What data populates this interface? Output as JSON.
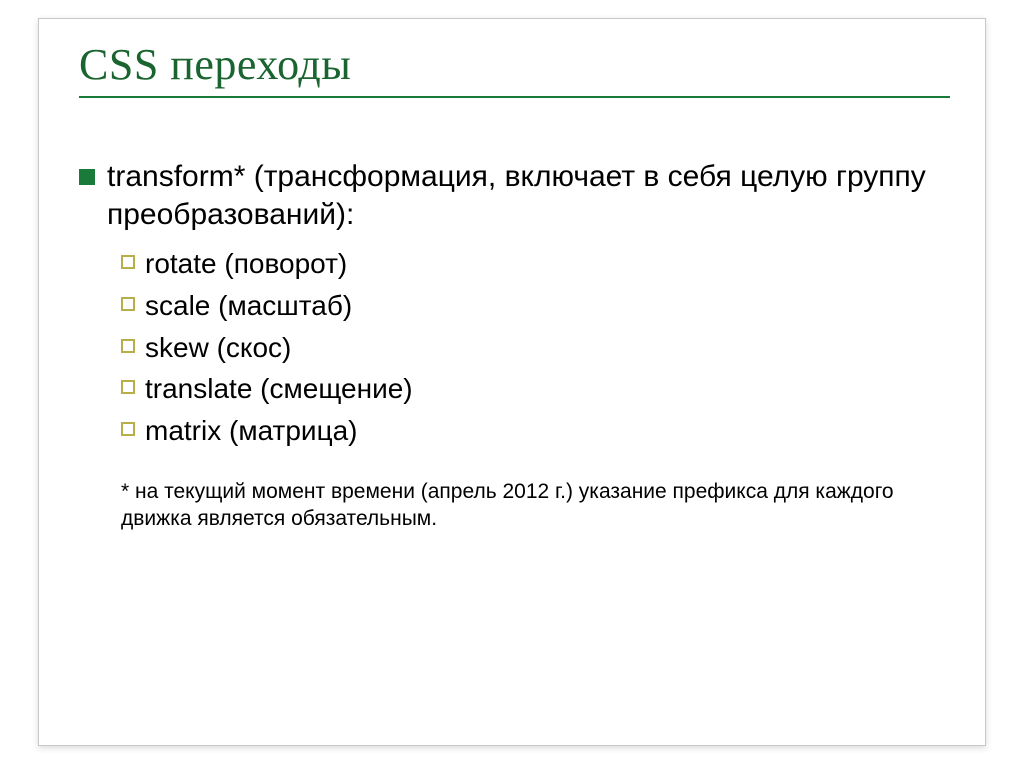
{
  "title": "CSS переходы",
  "main": {
    "text": "transform* (трансформация, включает в себя целую группу преобразований):"
  },
  "sub": [
    {
      "label": "rotate (поворот)"
    },
    {
      "label": "scale (масштаб)"
    },
    {
      "label": "skew (скос)"
    },
    {
      "label": "translate (смещение)"
    },
    {
      "label": "matrix (матрица)"
    }
  ],
  "footnote": "* на текущий момент времени (апрель 2012 г.) указание префикса для каждого движка является обязательным."
}
